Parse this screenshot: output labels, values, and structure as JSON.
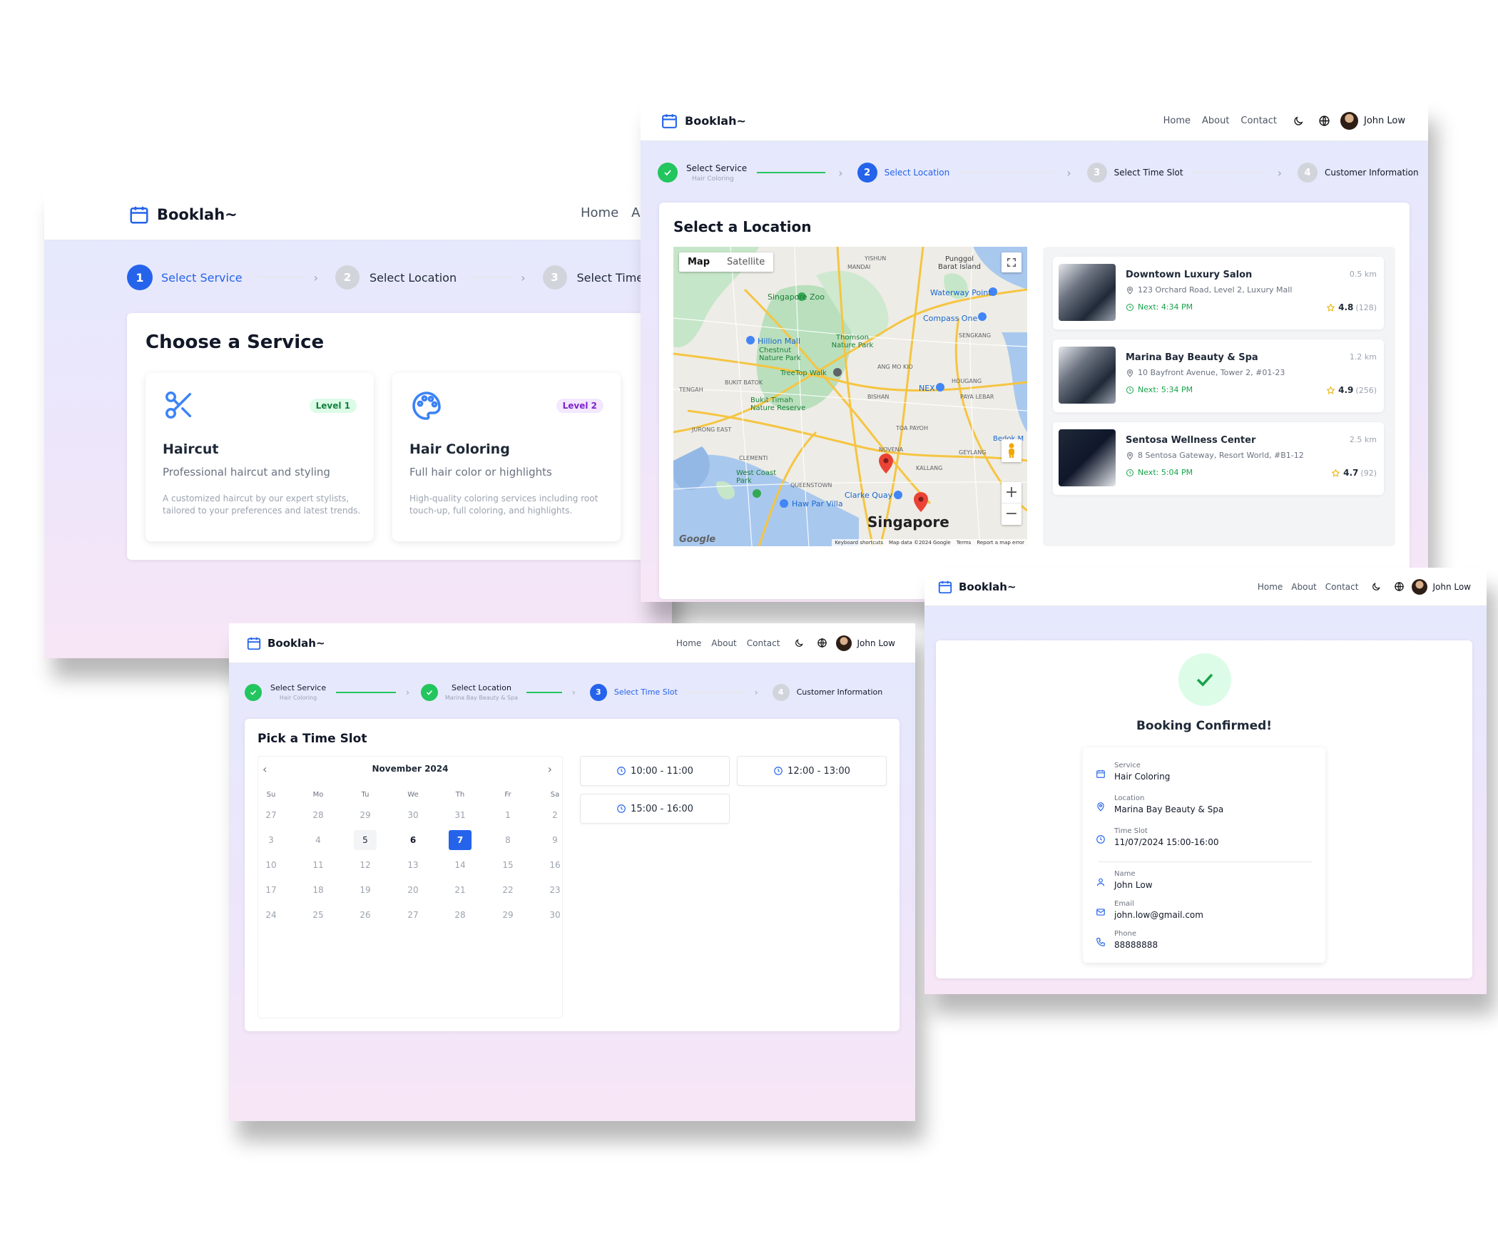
{
  "brand": "Booklah~",
  "nav": {
    "home": "Home",
    "about": "About",
    "contact": "Contact",
    "user": "John Low"
  },
  "nav_partial": {
    "about": "Ab"
  },
  "steps": {
    "service": "Select Service",
    "location": "Select Location",
    "time": "Select Time Slot",
    "customer": "Customer Information",
    "n1": "1",
    "n2": "2",
    "n3": "3",
    "n4": "4",
    "service_sub": "Hair Coloring",
    "location_sub": "Marina Bay Beauty & Spa"
  },
  "service_page": {
    "title": "Choose a Service",
    "services": [
      {
        "name": "Haircut",
        "level": "Level 1",
        "subtitle": "Professional haircut and styling",
        "desc": "A customized haircut by our expert stylists, tailored to your preferences and latest trends."
      },
      {
        "name": "Hair Coloring",
        "level": "Level 2",
        "subtitle": "Full hair color or highlights",
        "desc": "High-quality coloring services including root touch-up, full coloring, and highlights."
      }
    ]
  },
  "location_page": {
    "title": "Select a Location",
    "map": {
      "tab_map": "Map",
      "tab_satellite": "Satellite",
      "city": "Singapore",
      "google": "Google",
      "footer": [
        "Keyboard shortcuts",
        "Map data ©2024 Google",
        "Terms",
        "Report a map error"
      ],
      "zoom_in": "+",
      "zoom_out": "−",
      "labels": [
        "Singapore Zoo",
        "Hillion Mall",
        "Chestnut Nature Park",
        "TreeTop Walk",
        "Thomson Nature Park",
        "Bukit Timah Nature Reserve",
        "Waterway Point",
        "Compass One",
        "NEX",
        "West Coast Park",
        "Haw Par Villa",
        "Clarke Quay",
        "Punggol Barat Island",
        "YISHUN",
        "MANDAI",
        "SENGKANG",
        "HOUGANG",
        "PAYA LEBAR",
        "BUKIT BATOK",
        "TENGAH",
        "JURONG EAST",
        "CLEMENTI",
        "QUEENSTOWN",
        "TOA PAYOH",
        "NOVENA",
        "KALLANG",
        "GEYLANG",
        "BISHAN",
        "ANG MO KIO",
        "Bedok M"
      ]
    },
    "locations": [
      {
        "name": "Downtown Luxury Salon",
        "address": "123 Orchard Road, Level 2, Luxury Mall",
        "next": "Next: 4:34 PM",
        "dist": "0.5 km",
        "rating": "4.8",
        "reviews": "(128)"
      },
      {
        "name": "Marina Bay Beauty & Spa",
        "address": "10 Bayfront Avenue, Tower 2, #01-23",
        "next": "Next: 5:34 PM",
        "dist": "1.2 km",
        "rating": "4.9",
        "reviews": "(256)"
      },
      {
        "name": "Sentosa Wellness Center",
        "address": "8 Sentosa Gateway, Resort World, #B1-12",
        "next": "Next: 5:04 PM",
        "dist": "2.5 km",
        "rating": "4.7",
        "reviews": "(92)"
      }
    ]
  },
  "time_page": {
    "title": "Pick a Time Slot",
    "month": "November 2024",
    "weekdays": [
      "Su",
      "Mo",
      "Tu",
      "We",
      "Th",
      "Fr",
      "Sa"
    ],
    "days": [
      [
        "27",
        "28",
        "29",
        "30",
        "31",
        "1",
        "2"
      ],
      [
        "3",
        "4",
        "5",
        "6",
        "7",
        "8",
        "9"
      ],
      [
        "10",
        "11",
        "12",
        "13",
        "14",
        "15",
        "16"
      ],
      [
        "17",
        "18",
        "19",
        "20",
        "21",
        "22",
        "23"
      ],
      [
        "24",
        "25",
        "26",
        "27",
        "28",
        "29",
        "30"
      ]
    ],
    "slots": [
      "10:00 - 11:00",
      "12:00 - 13:00",
      "15:00 - 16:00"
    ]
  },
  "confirm_page": {
    "title": "Booking Confirmed!",
    "details": [
      {
        "label": "Service",
        "value": "Hair Coloring",
        "icon": "calendar-icon"
      },
      {
        "label": "Location",
        "value": "Marina Bay Beauty & Spa",
        "icon": "map-pin-icon"
      },
      {
        "label": "Time Slot",
        "value": "11/07/2024 15:00-16:00",
        "icon": "clock-icon"
      },
      {
        "label": "Name",
        "value": "John Low",
        "icon": "user-icon"
      },
      {
        "label": "Email",
        "value": "john.low@gmail.com",
        "icon": "mail-icon"
      },
      {
        "label": "Phone",
        "value": "88888888",
        "icon": "phone-icon"
      }
    ]
  },
  "colors": {
    "primary": "#2563eb",
    "success": "#22c55e",
    "star": "#eab308",
    "level1_bg": "#dcfce7",
    "level1_fg": "#15803d",
    "level2_bg": "#f3e8ff",
    "level2_fg": "#7e22ce"
  }
}
